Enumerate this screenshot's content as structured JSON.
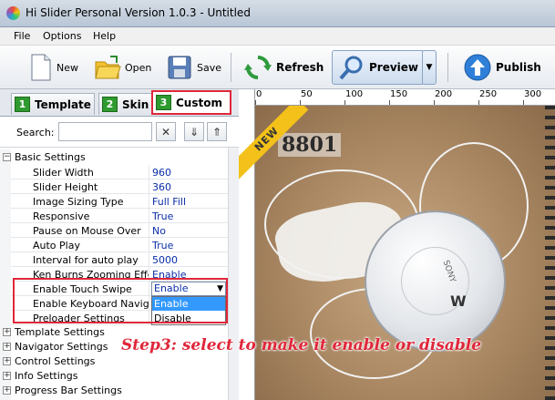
{
  "window": {
    "title": "Hi Slider Personal Version 1.0.3  - Untitled"
  },
  "menu": [
    "File",
    "Options",
    "Help"
  ],
  "toolbar": {
    "new_label": "New",
    "open_label": "Open",
    "save_label": "Save",
    "refresh_label": "Refresh",
    "preview_label": "Preview",
    "publish_label": "Publish"
  },
  "tabs": [
    {
      "num": "1",
      "label": "Template"
    },
    {
      "num": "2",
      "label": "Skin"
    },
    {
      "num": "3",
      "label": "Custom"
    }
  ],
  "search": {
    "label": "Search:",
    "value": ""
  },
  "basic_settings": {
    "header": "Basic Settings",
    "rows": [
      {
        "name": "Slider Width",
        "value": "960"
      },
      {
        "name": "Slider Height",
        "value": "360"
      },
      {
        "name": "Image Sizing Type",
        "value": "Full Fill"
      },
      {
        "name": "Responsive",
        "value": "True"
      },
      {
        "name": "Pause on Mouse Over",
        "value": "No"
      },
      {
        "name": "Auto Play",
        "value": "True"
      },
      {
        "name": "Interval for auto play",
        "value": "5000"
      },
      {
        "name": "Ken Burns Zooming Effect",
        "value": "Enable"
      },
      {
        "name": "Enable Touch Swipe",
        "value": "Enable"
      },
      {
        "name": "Enable Keyboard Navig...",
        "value": ""
      },
      {
        "name": "Preloader Settings",
        "value": ""
      }
    ]
  },
  "dropdown": {
    "selected": "Enable",
    "options": [
      "Enable",
      "Disable"
    ],
    "highlighted": "Enable"
  },
  "categories": [
    "Template Settings",
    "Navigator Settings",
    "Control Settings",
    "Info Settings",
    "Progress Bar Settings"
  ],
  "ruler": {
    "ticks": [
      "0",
      "50",
      "100",
      "150",
      "200",
      "250",
      "300"
    ]
  },
  "preview": {
    "stamp_text": "8801",
    "badge_text": "NEW",
    "brand": "SONY"
  },
  "annotation": "Step3: select to make it enable or disable",
  "colors": {
    "accent_red": "#e0273a",
    "tab_green": "#2f9a2f",
    "value_blue": "#0a2ea8",
    "highlight": "#3399ff"
  }
}
